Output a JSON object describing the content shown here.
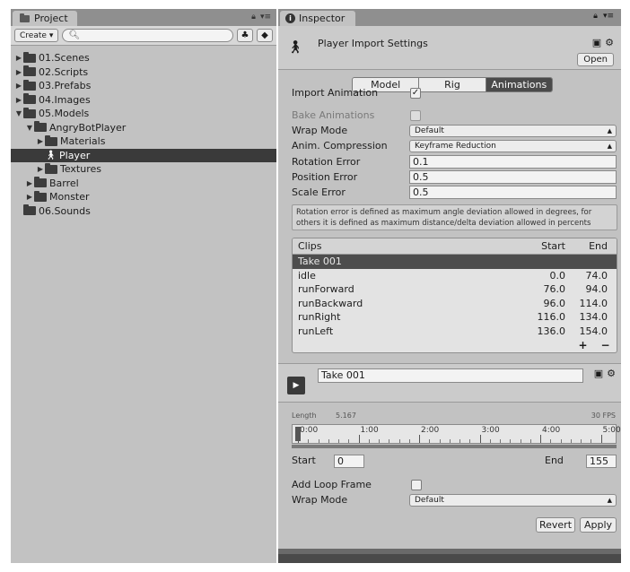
{
  "project": {
    "tab_label": "Project",
    "create_label": "Create",
    "search_placeholder": "",
    "tree": [
      {
        "label": "01.Scenes",
        "indent": 0,
        "arrow": "▶",
        "kind": "folder",
        "selected": false
      },
      {
        "label": "02.Scripts",
        "indent": 0,
        "arrow": "▶",
        "kind": "folder",
        "selected": false
      },
      {
        "label": "03.Prefabs",
        "indent": 0,
        "arrow": "▶",
        "kind": "folder",
        "selected": false
      },
      {
        "label": "04.Images",
        "indent": 0,
        "arrow": "▶",
        "kind": "folder",
        "selected": false
      },
      {
        "label": "05.Models",
        "indent": 0,
        "arrow": "▼",
        "kind": "folder",
        "selected": false
      },
      {
        "label": "AngryBotPlayer",
        "indent": 1,
        "arrow": "▼",
        "kind": "folder",
        "selected": false
      },
      {
        "label": "Materials",
        "indent": 2,
        "arrow": "▶",
        "kind": "folder",
        "selected": false
      },
      {
        "label": "Player",
        "indent": 2,
        "arrow": "",
        "kind": "model",
        "selected": true
      },
      {
        "label": "Textures",
        "indent": 2,
        "arrow": "▶",
        "kind": "folder",
        "selected": false
      },
      {
        "label": "Barrel",
        "indent": 1,
        "arrow": "▶",
        "kind": "folder",
        "selected": false
      },
      {
        "label": "Monster",
        "indent": 1,
        "arrow": "▶",
        "kind": "folder",
        "selected": false
      },
      {
        "label": "06.Sounds",
        "indent": 0,
        "arrow": "",
        "kind": "folder",
        "selected": false
      }
    ]
  },
  "inspector": {
    "tab_label": "Inspector",
    "title": "Player Import Settings",
    "open_label": "Open",
    "tabs": [
      {
        "label": "Model",
        "active": false
      },
      {
        "label": "Rig",
        "active": false
      },
      {
        "label": "Animations",
        "active": true
      }
    ],
    "import_animation": {
      "label": "Import Animation",
      "checked": true
    },
    "bake_animations": {
      "label": "Bake Animations",
      "checked": false
    },
    "wrap_mode": {
      "label": "Wrap Mode",
      "value": "Default"
    },
    "anim_compression": {
      "label": "Anim. Compression",
      "value": "Keyframe Reduction"
    },
    "rotation_error": {
      "label": "Rotation Error",
      "value": "0.1"
    },
    "position_error": {
      "label": "Position Error",
      "value": "0.5"
    },
    "scale_error": {
      "label": "Scale Error",
      "value": "0.5"
    },
    "help_text_line1": "Rotation error is defined as maximum angle deviation allowed in degrees, for",
    "help_text_line2": "others it is defined as maximum distance/delta deviation allowed in percents",
    "clips": {
      "header": {
        "name": "Clips",
        "start": "Start",
        "end": "End"
      },
      "rows": [
        {
          "name": "Take 001",
          "start": "",
          "end": "",
          "selected": true
        },
        {
          "name": "idle",
          "start": "0.0",
          "end": "74.0",
          "selected": false
        },
        {
          "name": "runForward",
          "start": "76.0",
          "end": "94.0",
          "selected": false
        },
        {
          "name": "runBackward",
          "start": "96.0",
          "end": "114.0",
          "selected": false
        },
        {
          "name": "runRight",
          "start": "116.0",
          "end": "134.0",
          "selected": false
        },
        {
          "name": "runLeft",
          "start": "136.0",
          "end": "154.0",
          "selected": false
        }
      ],
      "add_label": "+",
      "remove_label": "−"
    },
    "clip": {
      "name": "Take 001",
      "length_label": "Length",
      "length_value": "5.167",
      "fps_label": "30 FPS",
      "ticks": [
        "0:00",
        "1:00",
        "2:00",
        "3:00",
        "4:00",
        "5:00"
      ],
      "start_label": "Start",
      "start_value": "0",
      "end_label": "End",
      "end_value": "155",
      "add_loop_frame": {
        "label": "Add Loop Frame",
        "checked": false
      },
      "wrap_mode": {
        "label": "Wrap Mode",
        "value": "Default"
      }
    },
    "revert_label": "Revert",
    "apply_label": "Apply"
  }
}
